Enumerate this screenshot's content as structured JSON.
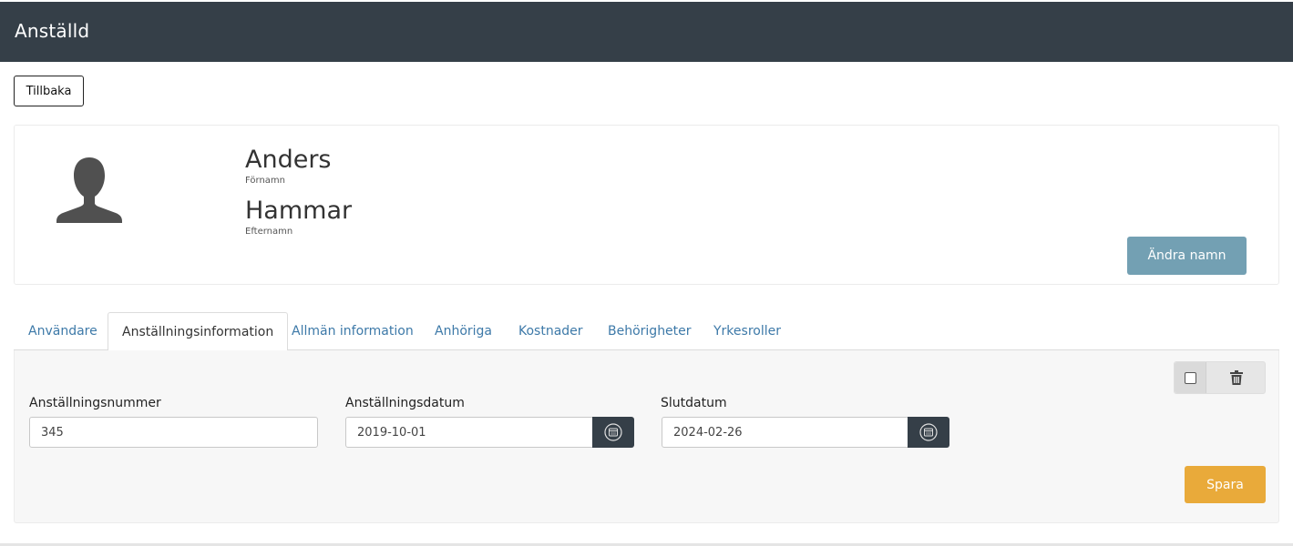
{
  "header": {
    "title": "Anställd"
  },
  "toolbar": {
    "back_label": "Tillbaka"
  },
  "profile": {
    "first_name": "Anders",
    "first_name_label": "Förnamn",
    "last_name": "Hammar",
    "last_name_label": "Efternamn",
    "rename_label": "Ändra namn",
    "avatar_icon": "user-silhouette-icon"
  },
  "tabs": [
    {
      "label": "Användare",
      "active": false
    },
    {
      "label": "Anställningsinformation",
      "active": true
    },
    {
      "label": "Allmän information",
      "active": false
    },
    {
      "label": "Anhöriga",
      "active": false
    },
    {
      "label": "Kostnader",
      "active": false
    },
    {
      "label": "Behörigheter",
      "active": false
    },
    {
      "label": "Yrkesroller",
      "active": false
    }
  ],
  "form": {
    "employee_number": {
      "label": "Anställningsnummer",
      "value": "345"
    },
    "start_date": {
      "label": "Anställningsdatum",
      "value": "2019-10-01"
    },
    "end_date": {
      "label": "Slutdatum",
      "value": "2024-02-26"
    },
    "save_label": "Spara"
  },
  "colors": {
    "header_bg": "#353f48",
    "rename_button": "#73a0b3",
    "save_button": "#e9aa3a",
    "tab_link": "#3d79a8"
  }
}
